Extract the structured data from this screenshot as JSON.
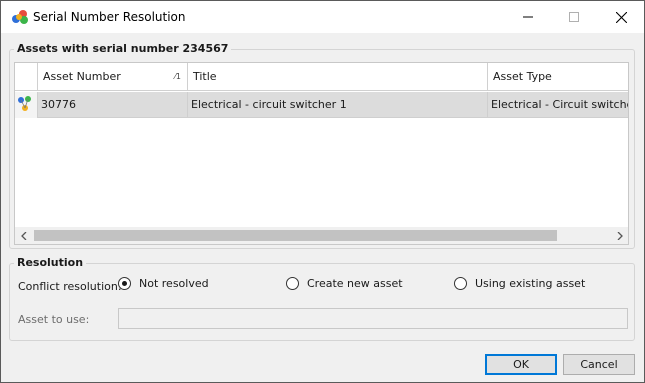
{
  "window": {
    "title": "Serial Number Resolution",
    "icon": "molecule-app-icon"
  },
  "assets_group": {
    "legend": "Assets with serial number 234567"
  },
  "grid": {
    "columns": [
      {
        "label": "Asset Number",
        "sort": "1"
      },
      {
        "label": "Title"
      },
      {
        "label": "Asset Type"
      }
    ],
    "rows": [
      {
        "asset_number": "30776",
        "title": "Electrical - circuit switcher 1",
        "asset_type": "Electrical - Circuit switchers",
        "row_icon": "asset-icon"
      }
    ]
  },
  "resolution": {
    "legend": "Resolution",
    "conflict_label": "Conflict resolution:",
    "options": [
      "Not resolved",
      "Create new asset",
      "Using existing asset"
    ],
    "selected": "Not resolved",
    "asset_to_use_label": "Asset to use:",
    "asset_to_use_value": ""
  },
  "buttons": {
    "ok": "OK",
    "cancel": "Cancel"
  },
  "colors": {
    "selected_row": "#dcdcdc",
    "default_button_border": "#0078d7"
  }
}
